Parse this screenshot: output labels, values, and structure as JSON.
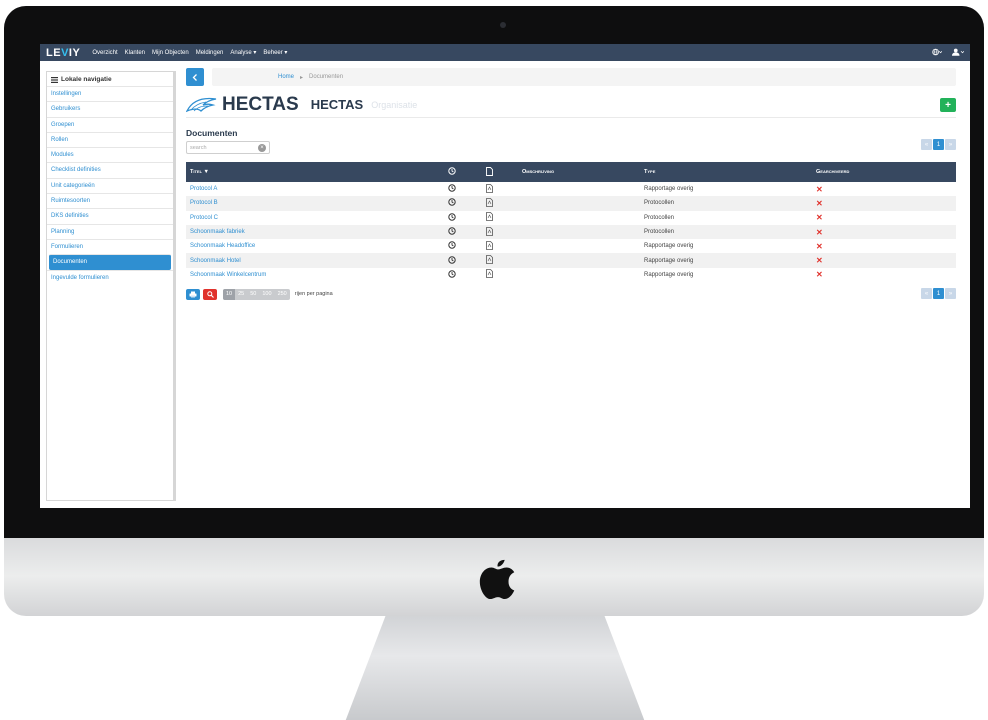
{
  "app": {
    "logo_text": "LEVIY"
  },
  "topnav": {
    "items": [
      "Overzicht",
      "Klanten",
      "Mijn Objecten",
      "Meldingen",
      "Analyse ▾",
      "Beheer ▾"
    ],
    "right_icons": [
      "globe-icon",
      "user-icon"
    ]
  },
  "sidebar": {
    "title": "Lokale navigatie",
    "items": [
      "Instellingen",
      "Gebruikers",
      "Groepen",
      "Rollen",
      "Modules",
      "Checklist definities",
      "Unit categorieën",
      "Ruimtesoorten",
      "DKS definities",
      "Planning",
      "Formulieren",
      "Documenten",
      "Ingevulde formulieren"
    ],
    "active": "Documenten"
  },
  "breadcrumb": {
    "home": "Home",
    "separator": "▸",
    "current": "Documenten"
  },
  "brand": {
    "logo_text": "HECTAS",
    "name": "HECTAS",
    "subtitle": "Organisatie"
  },
  "documents": {
    "title": "Documenten",
    "search_placeholder": "search",
    "columns": [
      "Titel ▼",
      "clock-icon",
      "file-icon",
      "Omschrijving",
      "Type",
      "Gearchiveerd"
    ],
    "rows": [
      {
        "title": "Protocol A",
        "description": "",
        "type": "Rapportage overig",
        "archived": "✕"
      },
      {
        "title": "Protocol B",
        "description": "",
        "type": "Protocollen",
        "archived": "✕"
      },
      {
        "title": "Protocol C",
        "description": "",
        "type": "Protocollen",
        "archived": "✕"
      },
      {
        "title": "Schoonmaak fabriek",
        "description": "",
        "type": "Protocollen",
        "archived": "✕"
      },
      {
        "title": "Schoonmaak Headoffice",
        "description": "",
        "type": "Rapportage overig",
        "archived": "✕"
      },
      {
        "title": "Schoonmaak Hotel",
        "description": "",
        "type": "Rapportage overig",
        "archived": "✕"
      },
      {
        "title": "Schoonmaak Winkelcentrum",
        "description": "",
        "type": "Rapportage overig",
        "archived": "✕"
      }
    ],
    "pagination": {
      "prev": "«",
      "page": "1",
      "next": "»"
    },
    "page_sizes": [
      "10",
      "25",
      "50",
      "100",
      "250"
    ],
    "page_size_selected": "10",
    "per_page_label": "rijen per pagina"
  },
  "colors": {
    "navbar": "#374860",
    "accent": "#2f8fd1",
    "add": "#22b25a",
    "danger": "#e0322c"
  }
}
